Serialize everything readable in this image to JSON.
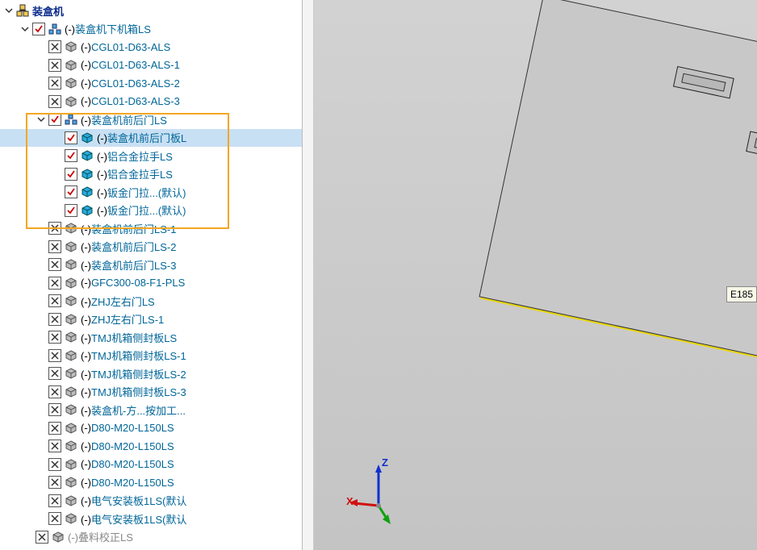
{
  "root": {
    "label": "装盒机"
  },
  "sub": {
    "prefix": "(-)",
    "label": "装盒机下机箱LS"
  },
  "children_lvl2_a": [
    {
      "prefix": "(-)",
      "label": "CGL01-D63-ALS"
    },
    {
      "prefix": "(-)",
      "label": "CGL01-D63-ALS-1"
    },
    {
      "prefix": "(-)",
      "label": "CGL01-D63-ALS-2"
    },
    {
      "prefix": "(-)",
      "label": "CGL01-D63-ALS-3"
    }
  ],
  "expanded_asm": {
    "prefix": "(-)",
    "label": "装盒机前后门LS"
  },
  "expanded_children": [
    {
      "prefix": "(-)",
      "label": "装盒机前后门板L",
      "selected": true
    },
    {
      "prefix": "(-)",
      "label": "铝合金拉手LS"
    },
    {
      "prefix": "(-)",
      "label": "铝合金拉手LS"
    },
    {
      "prefix": "(-)",
      "label": "钣金门拉...(默认)"
    },
    {
      "prefix": "(-)",
      "label": "钣金门拉...(默认)"
    }
  ],
  "children_lvl2_b": [
    {
      "prefix": "(-)",
      "label": "装盒机前后门LS-1"
    },
    {
      "prefix": "(-)",
      "label": "装盒机前后门LS-2"
    },
    {
      "prefix": "(-)",
      "label": "装盒机前后门LS-3"
    },
    {
      "prefix": "(-)",
      "label": "GFC300-08-F1-PLS"
    },
    {
      "prefix": "(-)",
      "label": "ZHJ左右门LS"
    },
    {
      "prefix": "(-)",
      "label": "ZHJ左右门LS-1"
    },
    {
      "prefix": "(-)",
      "label": "TMJ机箱侧封板LS"
    },
    {
      "prefix": "(-)",
      "label": "TMJ机箱侧封板LS-1"
    },
    {
      "prefix": "(-)",
      "label": "TMJ机箱侧封板LS-2"
    },
    {
      "prefix": "(-)",
      "label": "TMJ机箱侧封板LS-3"
    },
    {
      "prefix": "(-)",
      "label": "装盒机-方...按加工..."
    },
    {
      "prefix": "(-)",
      "label": "D80-M20-L150LS"
    },
    {
      "prefix": "(-)",
      "label": "D80-M20-L150LS"
    },
    {
      "prefix": "(-)",
      "label": "D80-M20-L150LS"
    },
    {
      "prefix": "(-)",
      "label": "D80-M20-L150LS"
    },
    {
      "prefix": "(-)",
      "label": "电气安装板1LS(默认"
    },
    {
      "prefix": "(-)",
      "label": "电气安装板1LS(默认"
    }
  ],
  "last": {
    "prefix": "(-)",
    "label": "叠料校正LS"
  },
  "axes": {
    "x": "X",
    "z": "Z"
  },
  "tag": "E185"
}
